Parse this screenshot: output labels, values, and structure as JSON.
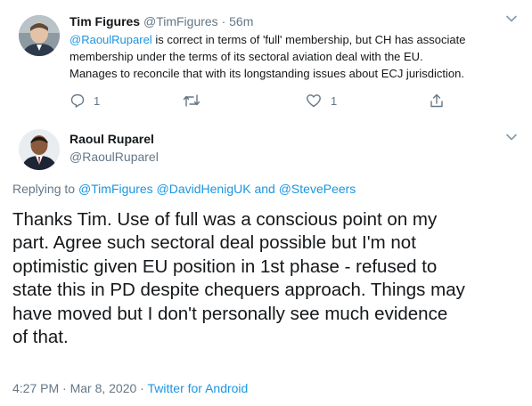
{
  "parent_tweet": {
    "author_name": "Tim Figures",
    "handle": "@TimFigures",
    "separator": "·",
    "time": "56m",
    "mention": "@RaoulRuparel",
    "text_line1_rest": " is correct in terms of 'full' membership, but CH has associate",
    "text_line2": "membership under the terms of its sectoral aviation deal with the EU.",
    "text_line3": "Manages to reconcile that with its longstanding issues about ECJ jurisdiction.",
    "reply_count": "1",
    "retweet_count": "",
    "like_count": "1"
  },
  "main_tweet": {
    "author_name": "Raoul Ruparel",
    "handle": "@RaoulRuparel",
    "replying_prefix": "Replying to ",
    "replying_to": [
      "@TimFigures",
      "@DavidHenigUK",
      "and",
      "@StevePeers"
    ],
    "body_lines": [
      "Thanks Tim. Use of full was a conscious point on my",
      "part. Agree such sectoral deal possible but I'm not",
      "optimistic given EU position in 1st phase - refused to",
      "state this in PD despite chequers approach. Things may",
      "have moved but I don't personally see much evidence",
      "of that."
    ],
    "timestamp": "4:27 PM · Mar 8, 2020",
    "source_separator": " · ",
    "source": "Twitter for Android"
  },
  "icons": {
    "reply": "reply-icon",
    "retweet": "retweet-icon",
    "like": "heart-icon",
    "share": "share-icon",
    "menu": "chevron-down-icon"
  },
  "colors": {
    "link": "#1b95e0",
    "muted": "#657786",
    "text": "#14171a"
  }
}
